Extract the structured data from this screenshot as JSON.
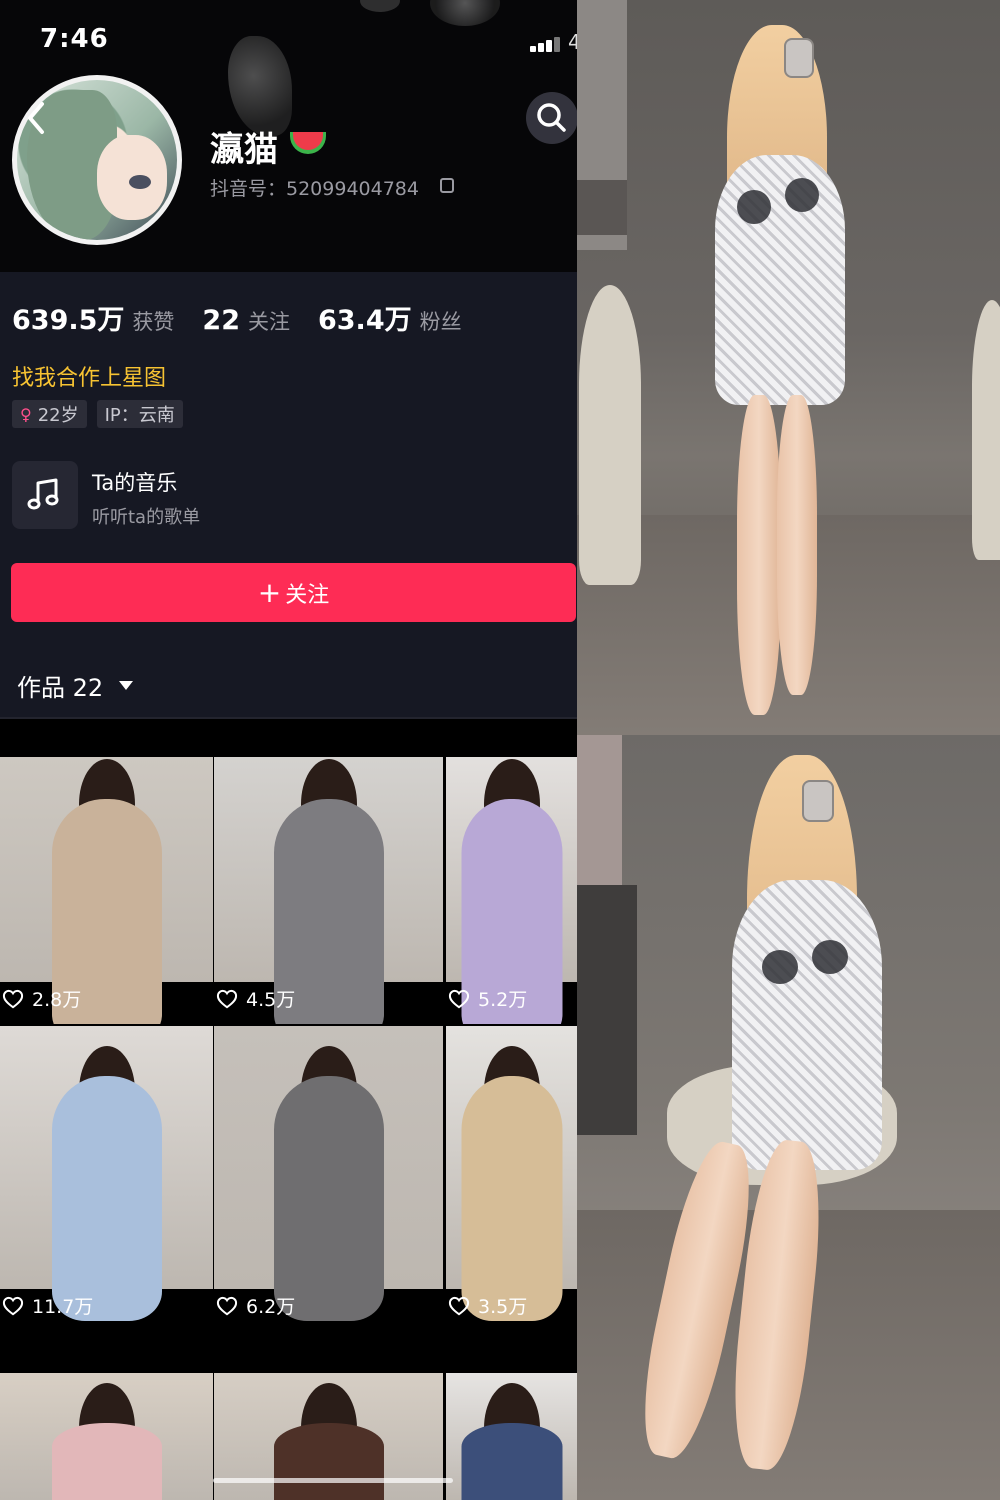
{
  "status_bar": {
    "time": "7:46",
    "battery": "4"
  },
  "profile": {
    "nickname": "瀛猫",
    "douyin_id": "抖音号：52099404784",
    "stats": [
      {
        "value": "639.5万",
        "label": "获赞"
      },
      {
        "value": "22",
        "label": "关注"
      },
      {
        "value": "63.4万",
        "label": "粉丝"
      }
    ],
    "promo_text": "找我合作上星图",
    "tags": {
      "age": "22岁",
      "ip": "IP：云南"
    },
    "music": {
      "title": "Ta的音乐",
      "subtitle": "听听ta的歌单"
    },
    "follow_button": "关注",
    "works_label": "作品 22"
  },
  "videos": [
    {
      "likes": "2.8万",
      "dress": "#c9b29a",
      "bg": "#cdc8c1"
    },
    {
      "likes": "4.5万",
      "dress": "#7d7c80",
      "bg": "#d4d2cf"
    },
    {
      "likes": "5.2万",
      "dress": "#b8a8d6",
      "bg": "#e3e0de"
    },
    {
      "likes": "11.7万",
      "dress": "#a9bfdc",
      "bg": "#dedad6"
    },
    {
      "likes": "6.2万",
      "dress": "#6f6e70",
      "bg": "#c5c0ba"
    },
    {
      "likes": "3.5万",
      "dress": "#d6bd97",
      "bg": "#e4e2df"
    },
    {
      "likes": "",
      "dress": "#e2b7b9",
      "bg": "#d8cfc4"
    },
    {
      "likes": "",
      "dress": "#4e3128",
      "bg": "#d6cec4"
    },
    {
      "likes": "",
      "dress": "#3c4f7a",
      "bg": "#e6e4e2"
    }
  ],
  "colors": {
    "accent": "#fe2c55",
    "promo": "#f7c332",
    "panel": "#161823"
  },
  "icons": [
    "back-icon",
    "search-icon",
    "copy-icon",
    "music-note-icon",
    "heart-icon",
    "gender-female-icon",
    "caret-down-icon"
  ]
}
